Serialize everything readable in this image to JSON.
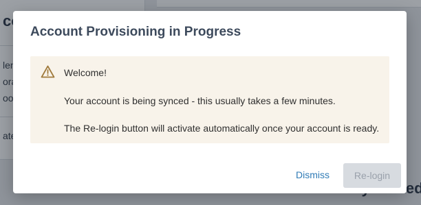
{
  "background": {
    "left_heading": "co",
    "left_lines": [
      "len",
      "ora",
      "oon"
    ],
    "left_line_2": "ate",
    "right_heading": "Recently Visited"
  },
  "modal": {
    "title": "Account Provisioning in Progress",
    "notice": {
      "icon": "warning-triangle-icon",
      "greeting": "Welcome!",
      "line_sync": "Your account is being synced - this usually takes a few minutes.",
      "line_relogin": "The Re-login button will activate automatically once your account is ready."
    },
    "actions": {
      "dismiss_label": "Dismiss",
      "relogin_label": "Re-login"
    }
  },
  "colors": {
    "title": "#3d4a5c",
    "notice_bg": "#f8f3ea",
    "warning_icon": "#a07a3c",
    "link": "#2f7bb6",
    "disabled_button_bg": "#d7dbe0",
    "disabled_button_text": "#9aa1ab"
  }
}
